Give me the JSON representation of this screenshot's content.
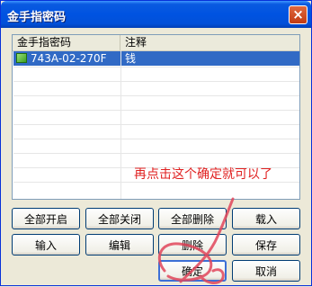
{
  "window": {
    "title": "金手指密码",
    "close_glyph": "×"
  },
  "list": {
    "columns": [
      "金手指密码",
      "注释"
    ],
    "rows": [
      {
        "code": "743A-02-270F",
        "note": "钱",
        "selected": true,
        "icon": "cheat-code-icon"
      }
    ]
  },
  "annotation": {
    "text": "再点击这个确定就可以了",
    "color": "#e02020"
  },
  "buttons": {
    "enable_all": "全部开启",
    "disable_all": "全部关闭",
    "delete_all": "全部删除",
    "load": "载入",
    "input": "输入",
    "edit": "编辑",
    "delete": "删除",
    "save": "保存",
    "ok": "确定",
    "cancel": "取消"
  },
  "colors": {
    "selection": "#316ac5",
    "title_bar": "#0053e1",
    "annotation_red": "#e02020"
  }
}
